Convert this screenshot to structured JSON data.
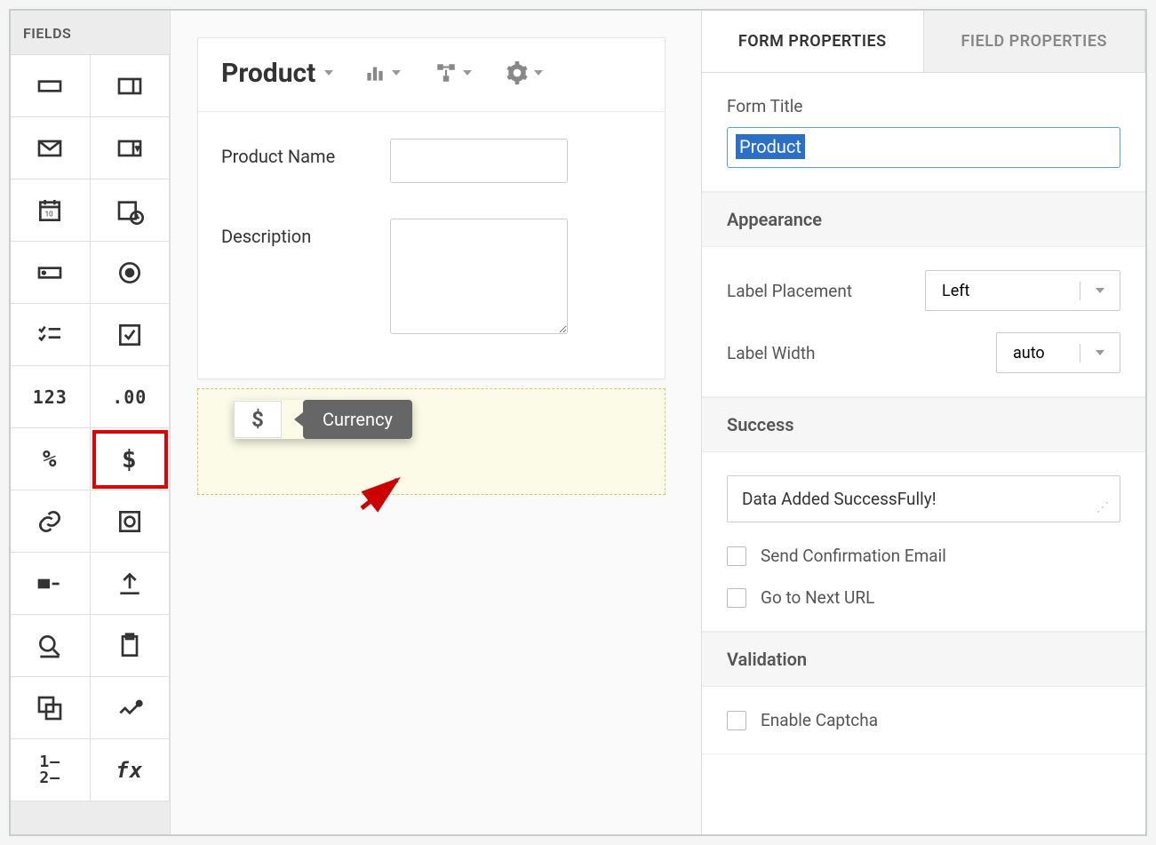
{
  "sidebar": {
    "title": "FIELDS"
  },
  "palette": [
    {
      "name": "single-line-icon"
    },
    {
      "name": "multi-line-icon"
    },
    {
      "name": "email-icon"
    },
    {
      "name": "dropdown-icon"
    },
    {
      "name": "date-icon"
    },
    {
      "name": "datetime-icon"
    },
    {
      "name": "lookup-icon"
    },
    {
      "name": "radio-icon"
    },
    {
      "name": "multiselect-icon"
    },
    {
      "name": "checkbox-icon"
    },
    {
      "name": "number-icon",
      "text": "123"
    },
    {
      "name": "decimal-icon",
      "text": ".00"
    },
    {
      "name": "percent-icon",
      "text": "%"
    },
    {
      "name": "currency-icon",
      "text": "$",
      "highlight": true
    },
    {
      "name": "url-link-icon"
    },
    {
      "name": "image-icon"
    },
    {
      "name": "decision-icon"
    },
    {
      "name": "upload-icon"
    },
    {
      "name": "search-icon"
    },
    {
      "name": "clipboard-icon"
    },
    {
      "name": "subform-icon"
    },
    {
      "name": "signature-icon"
    },
    {
      "name": "autonumber-icon"
    },
    {
      "name": "formula-icon",
      "text": "fx"
    }
  ],
  "form": {
    "name": "Product",
    "fields": [
      {
        "label": "Product Name",
        "type": "text"
      },
      {
        "label": "Description",
        "type": "textarea"
      }
    ],
    "drag_tooltip": "Currency",
    "drag_icon_char": "$"
  },
  "props": {
    "tabs": {
      "form": "FORM PROPERTIES",
      "field": "FIELD PROPERTIES"
    },
    "form_title_label": "Form Title",
    "form_title_value": "Product",
    "appearance_header": "Appearance",
    "label_placement_label": "Label Placement",
    "label_placement_value": "Left",
    "label_width_label": "Label Width",
    "label_width_value": "auto",
    "success_header": "Success",
    "success_message": "Data Added SuccessFully!",
    "send_confirmation": "Send Confirmation Email",
    "goto_next_url": "Go to Next URL",
    "validation_header": "Validation",
    "enable_captcha": "Enable Captcha"
  }
}
